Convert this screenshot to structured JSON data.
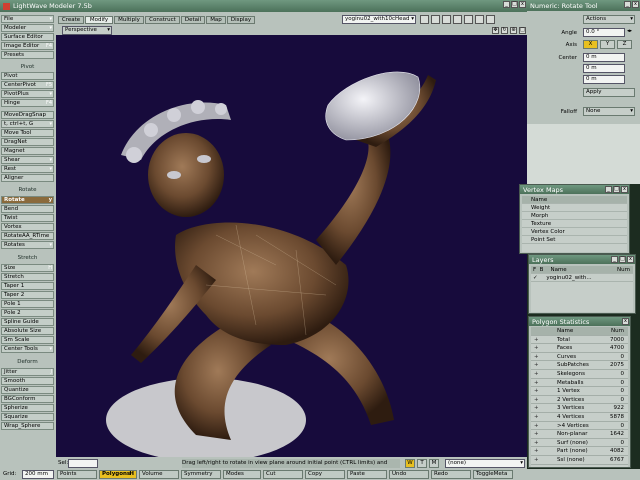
{
  "app": {
    "title": "LightWave Modeler 7.5b"
  },
  "tabs": [
    "Create",
    "Modify",
    "Multiply",
    "Construct",
    "Detail",
    "Map",
    "Display"
  ],
  "active_tab": "Modify",
  "menus": {
    "file": "File",
    "modeler": "Modeler",
    "surface_editor": "Surface Editor",
    "image_editor": "Image Editor",
    "presets": "Presets"
  },
  "layer_select": "yoginu02_with10cHead",
  "viewport": {
    "mode": "Perspective"
  },
  "sidebar": {
    "pivot": {
      "header": "Pivot",
      "items": [
        "Pivot",
        "CenterPivot",
        "PivotPlus",
        "Hinge"
      ]
    },
    "move": {
      "items": [
        "MoveDragSnap",
        "t, ctrl+t, G",
        "Move Tool",
        "DragNet",
        "Magnet",
        "Shear",
        "Rest",
        "Aligner"
      ]
    },
    "rotate": {
      "header": "Rotate",
      "items": [
        "Rotate",
        "Bend",
        "Twist",
        "Vortex",
        "RotateAA_RTime",
        "Rotates"
      ]
    },
    "stretch": {
      "header": "Stretch",
      "items": [
        "Size",
        "Stretch",
        "Taper 1",
        "Taper 2",
        "Pole 1",
        "Pole 2",
        "Spline Guide",
        "Absolute Size",
        "Sm Scale",
        "Center Tools"
      ]
    },
    "deform": {
      "header": "Deform",
      "items": [
        "Jitter",
        "Smooth",
        "Quantize",
        "BGConform",
        "Spherize",
        "Squarize",
        "Wrap_Sphere"
      ]
    },
    "keys": {
      "image_editor": "F4",
      "centerpivot": "F5",
      "hinge": "F4",
      "rotate": "y",
      "size": "H",
      "jitter": "J"
    }
  },
  "numeric": {
    "title": "Numeric: Rotate Tool",
    "actions_label": "Actions",
    "angle_label": "Angle",
    "angle_value": "0.0 °",
    "axis_label": "Axis",
    "axes": [
      "X",
      "Y",
      "Z"
    ],
    "active_axis": "X",
    "center_label": "Center",
    "center_values": [
      "0 m",
      "0 m",
      "0 m"
    ],
    "apply_label": "Apply",
    "falloff_label": "Falloff",
    "falloff_value": "None"
  },
  "vertex_maps": {
    "title": "Vertex Maps",
    "col": "Name",
    "items": [
      "Weight",
      "Morph",
      "Texture",
      "Vertex Color",
      "Point Set"
    ]
  },
  "layers": {
    "title": "Layers",
    "cols": [
      "F",
      "B",
      "Name",
      "Num"
    ],
    "item": "yoginu02_with..."
  },
  "poly_stats": {
    "title": "Polygon Statistics",
    "cols": [
      "Name",
      "Num"
    ],
    "rows": [
      {
        "name": "Total",
        "value": "7000"
      },
      {
        "name": "Faces",
        "value": "4700"
      },
      {
        "name": "Curves",
        "value": "0"
      },
      {
        "name": "SubPatches",
        "value": "2075"
      },
      {
        "name": "Skelegons",
        "value": "0"
      },
      {
        "name": "Metaballs",
        "value": "0"
      },
      {
        "name": "1 Vertex",
        "value": "0"
      },
      {
        "name": "2 Vertices",
        "value": "0"
      },
      {
        "name": "3 Vertices",
        "value": "922"
      },
      {
        "name": "4 Vertices",
        "value": "5878"
      },
      {
        "name": ">4 Vertices",
        "value": "0"
      },
      {
        "name": "Non-planar",
        "value": "1642"
      },
      {
        "name": "Surf (none)",
        "value": "0"
      },
      {
        "name": "Part (none)",
        "value": "4082"
      },
      {
        "name": "Ssl (none)",
        "value": "6767"
      }
    ]
  },
  "status": {
    "grid_label": "Grid:",
    "grid_value": "200 mm",
    "sel_label": "Sel:",
    "message": "Drag left/right to rotate in view plane around initial point (CTRL limits) and",
    "wtm": [
      "W",
      "T",
      "M"
    ],
    "map_value": "(none)"
  },
  "bottom": {
    "items": [
      "Points",
      "Polygons",
      "Volume",
      "Symmetry",
      "Modes",
      "Cut",
      "Copy",
      "Paste",
      "Undo",
      "Redo",
      "ToggleMeta"
    ],
    "active": "Polygons",
    "polygon_key": "H"
  },
  "colors": {
    "viewport_bg": "#170b3c",
    "active_button": "#8a6a3c",
    "panel": "#b8c2bc",
    "titlebar": "#5b8068"
  }
}
